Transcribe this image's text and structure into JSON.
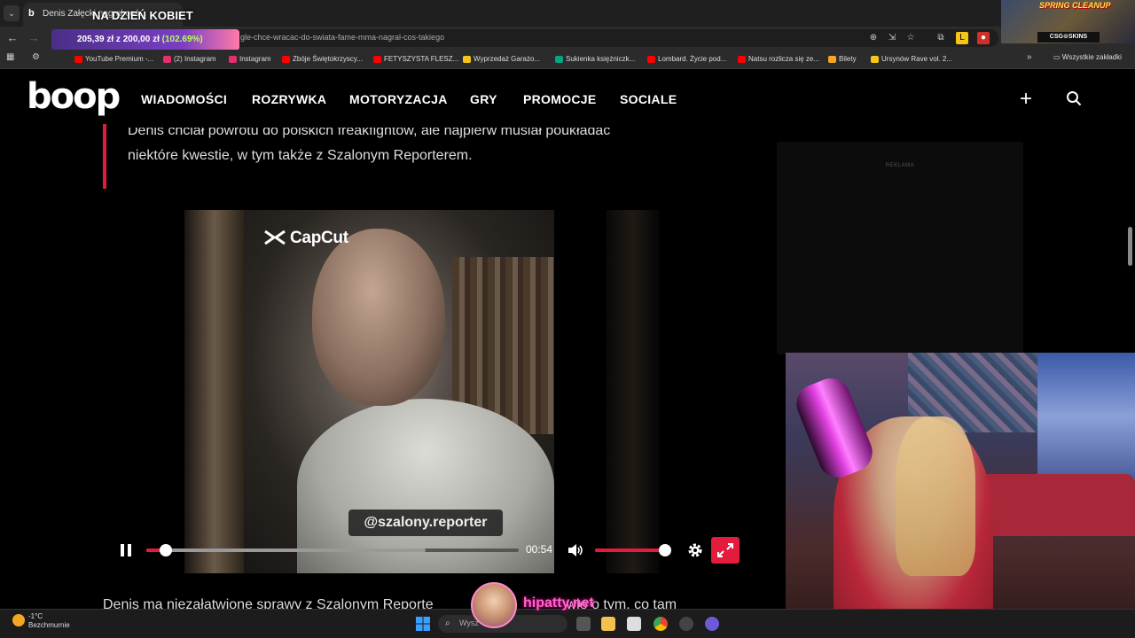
{
  "browser": {
    "tab_title": "Denis Załęcki nagrał coś...",
    "url_fragment": "gle-chce-wracac-do-swiata-fame-mma-nagral-cos-takiego",
    "bookmarks": [
      {
        "label": "YouTube Premium -...",
        "color": "#ff0000"
      },
      {
        "label": "(2) Instagram",
        "color": "#e1306c"
      },
      {
        "label": "Instagram",
        "color": "#e1306c"
      },
      {
        "label": "Zbóje Świętokrzyscy...",
        "color": "#ff0000"
      },
      {
        "label": "FETYSZYSTA FLESZ...",
        "color": "#ff0000"
      },
      {
        "label": "Wyprzedaż Garażo...",
        "color": "#f5c518"
      },
      {
        "label": "Sukienka księżniczk...",
        "color": "#00a67e"
      },
      {
        "label": "Lombard. Życie pod...",
        "color": "#ff0000"
      },
      {
        "label": "Natsu rozlicza się ze...",
        "color": "#ff0000"
      },
      {
        "label": "Bilety",
        "color": "#f5a623"
      },
      {
        "label": "Ursynów Rave vol. 2...",
        "color": "#f5c518"
      }
    ],
    "all_bookmarks": "Wszystkie zakładki"
  },
  "stream_overlay": {
    "top_banner": "NA DZIEŃ KOBIET",
    "donation_text": "205,39 zł z 200,00 zł",
    "donation_pct": "(102.69%)",
    "spring_banner": "SPRING CLEANUP",
    "sponsor": "CSG⊙SKINS",
    "chat_name": "hipatty.net"
  },
  "site": {
    "logo": "boop",
    "nav": [
      "WIADOMOŚCI",
      "ROZRYWKA",
      "MOTORYZACJA",
      "GRY",
      "PROMOCJE",
      "SOCIALE"
    ],
    "accent": "#e31c3d"
  },
  "article": {
    "quote_line1": "Denis chciał powrotu do polskich freakfightów, ale najpierw musiał poukładać",
    "quote_line2": "niektóre kwestie, w tym także z Szalonym Reporterem.",
    "ad_label": "REKLAMA",
    "paragraph_start": "Denis ma niezałatwione sprawy z Szalonym Reporte",
    "paragraph_end": "wie o tym, co tam"
  },
  "video": {
    "watermark": "CapCut",
    "handle": "@szalony.reporter",
    "time": "00:54",
    "progress": 0.04,
    "buffered": 0.75,
    "volume": 1.0
  },
  "taskbar": {
    "temp": "-1°C",
    "weather": "Bezchmurnie",
    "search": "Wysz"
  }
}
